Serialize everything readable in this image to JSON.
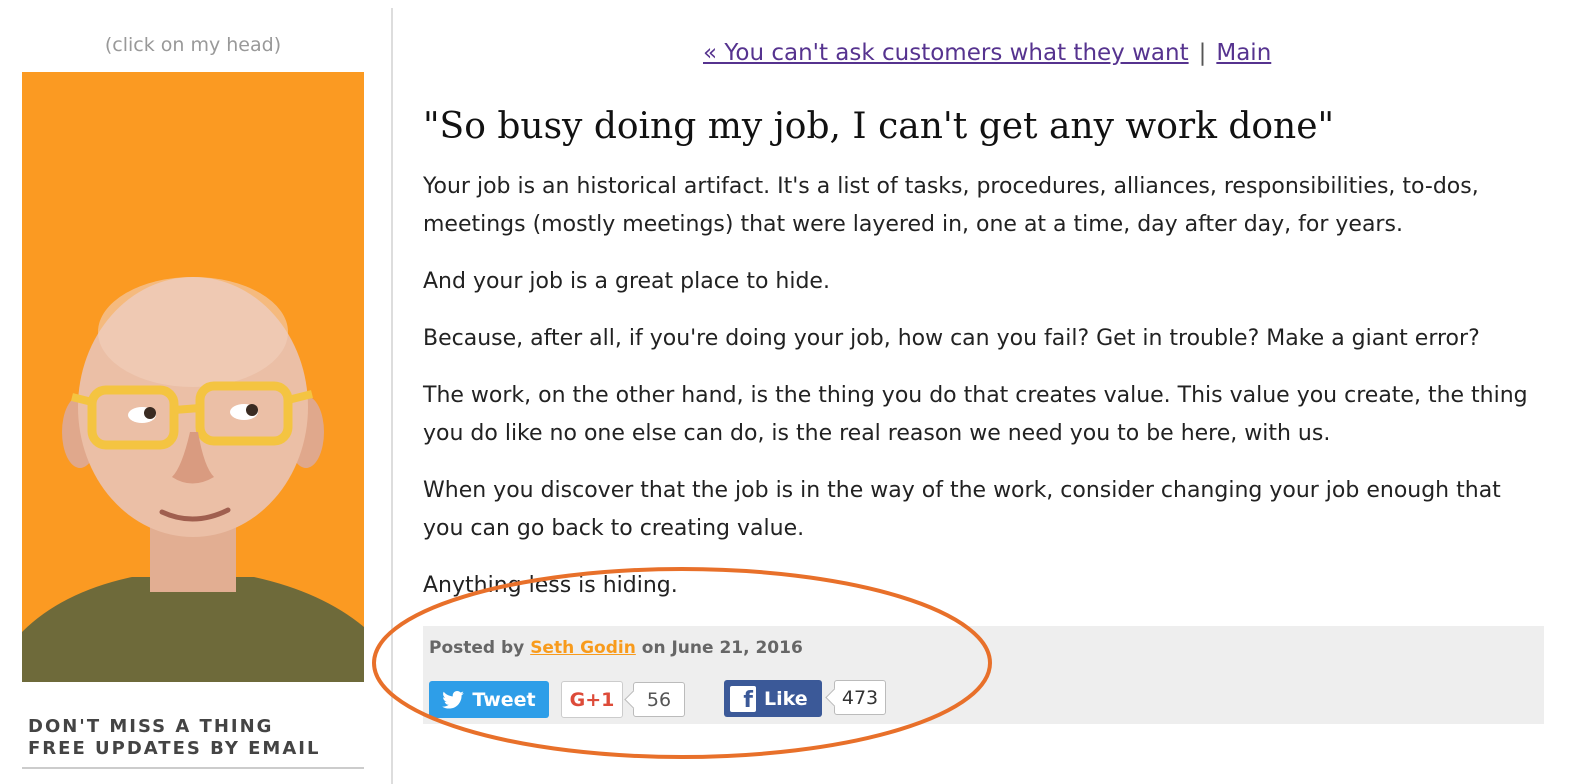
{
  "sidebar": {
    "click_hint": "(click on my head)",
    "signup_line1": "DON'T MISS A THING",
    "signup_line2": "FREE UPDATES BY EMAIL"
  },
  "nav": {
    "prev_link": "« You can't ask customers what they want",
    "separator": "|",
    "main_link": "Main"
  },
  "post": {
    "title": "\"So busy doing my job, I can't get any work done\"",
    "paragraphs": [
      "Your job is an historical artifact. It's a list of tasks, procedures, alliances, responsibilities, to-dos, meetings (mostly meetings) that were layered in, one at a time, day after day, for years.",
      "And your job is a great place to hide.",
      "Because, after all, if you're doing your job, how can you fail? Get in trouble? Make a giant error?",
      "The work, on the other hand, is the thing you do that creates value. This value you create, the thing you do like no one else can do, is the real reason we need you to be here, with us.",
      "When you discover that the job is in the way of the work, consider changing your job enough that you can go back to creating value.",
      "Anything less is hiding."
    ]
  },
  "footer": {
    "posted_prefix": "Posted by",
    "author": "Seth Godin",
    "posted_on": "on June 21, 2016"
  },
  "social": {
    "tweet_label": "Tweet",
    "gplus_label": "G+1",
    "gplus_count": "56",
    "like_label": "Like",
    "like_count": "473",
    "fb_glyph": "f"
  },
  "colors": {
    "portrait_bg": "#fb9a22",
    "link_purple": "#56338f",
    "author_orange": "#f89b1c",
    "tweet_blue": "#2e9ee8",
    "facebook_blue": "#3b5998",
    "gplus_red": "#dd4b39",
    "annotation_orange": "#e8702a"
  }
}
